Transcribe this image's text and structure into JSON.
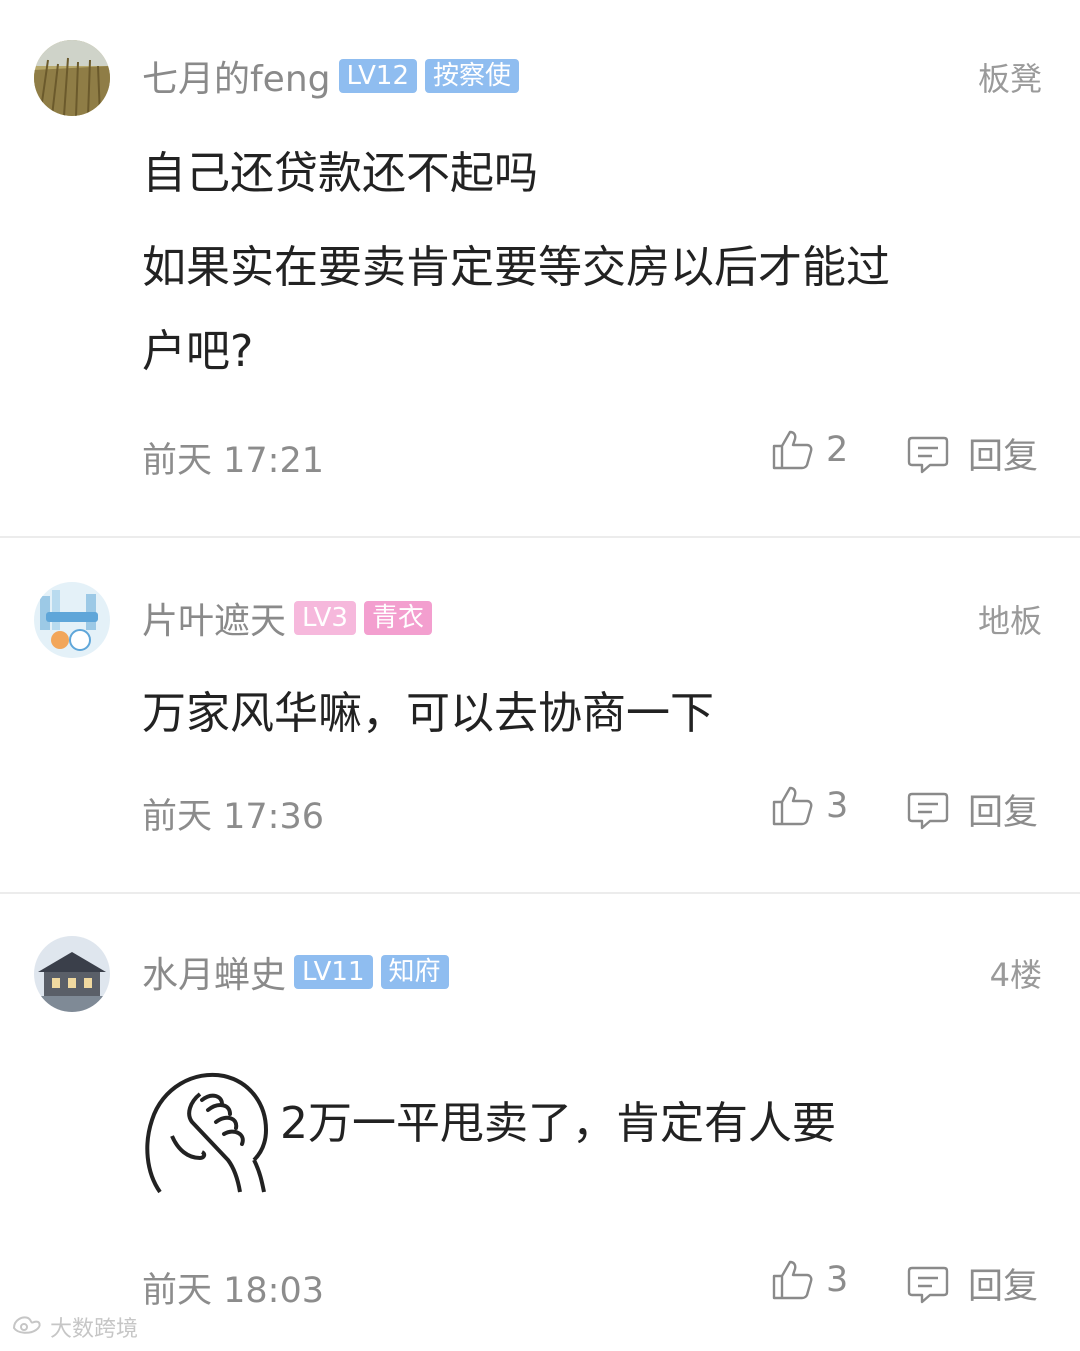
{
  "comments": [
    {
      "username": "七月的feng",
      "level": "LV12",
      "title_badge": "按察使",
      "level_color": "#8fbdf0",
      "title_color": "#8fbdf0",
      "floor": "板凳",
      "lines": [
        "自己还贷款还不起吗",
        "如果实在要卖肯定要等交房以后才能过",
        "户吧?"
      ],
      "time": "前天 17:21",
      "likes": "2",
      "reply_label": "回复"
    },
    {
      "username": "片叶遮天",
      "level": "LV3",
      "title_badge": "青衣",
      "level_color": "#f6b8dc",
      "title_color": "#f39fcf",
      "floor": "地板",
      "lines": [
        "万家风华嘛，可以去协商一下"
      ],
      "time": "前天 17:36",
      "likes": "3",
      "reply_label": "回复"
    },
    {
      "username": "水月蝉史",
      "level": "LV11",
      "title_badge": "知府",
      "level_color": "#8fbdf0",
      "title_color": "#8fbdf0",
      "floor": "4楼",
      "emoji": "facepalm-emoji",
      "lines": [
        "2万一平甩卖了，肯定有人要"
      ],
      "time": "前天 18:03",
      "likes": "3",
      "reply_label": "回复"
    }
  ],
  "watermark": "大数跨境",
  "icons": {
    "like": "thumbs-up-icon",
    "reply": "comment-bubble-icon"
  }
}
